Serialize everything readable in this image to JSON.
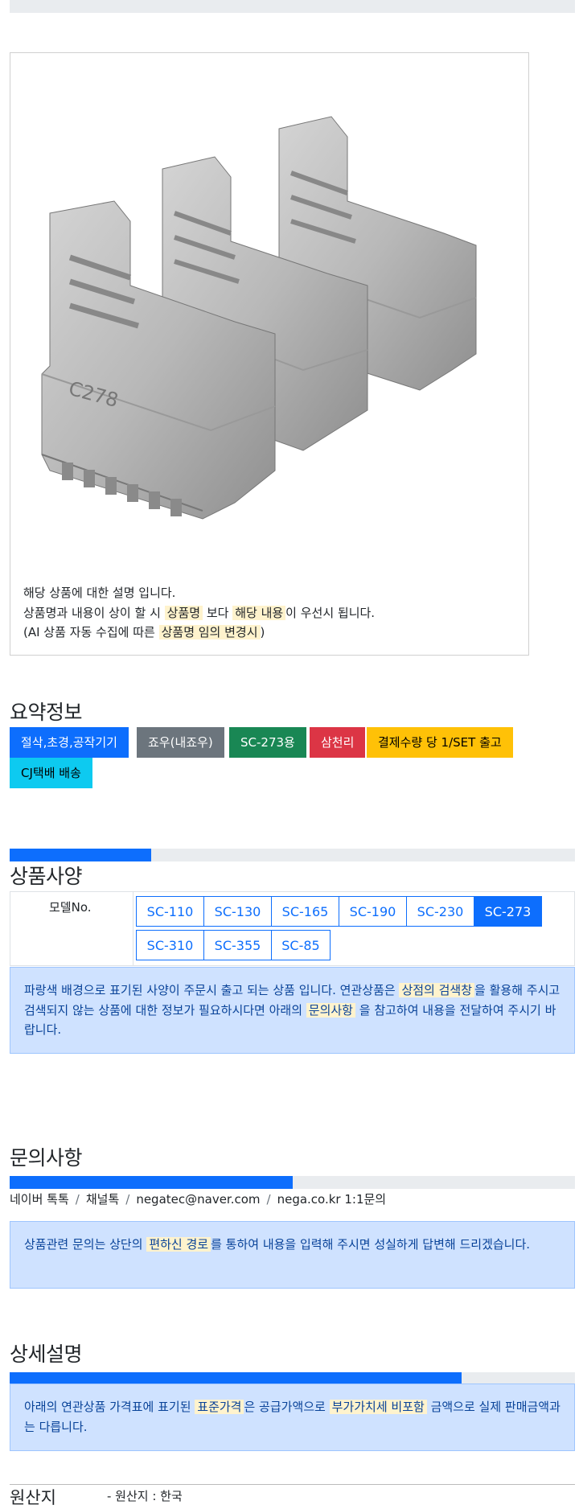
{
  "description": {
    "line1": "해당 상품에 대한 설명 입니다.",
    "line2_a": "상품명과 내용이 상이 할 시 ",
    "line2_h1": "상품명",
    "line2_b": " 보다 ",
    "line2_h2": "해당 내용",
    "line2_c": "이 우선시 됩니다.",
    "line3_a": "(AI 상품 자동 수집에 따른 ",
    "line3_h": "상품명 임의 변경시",
    "line3_b": ")"
  },
  "product_image_alt": "SC-273 soft jaws set",
  "summary": {
    "title": "요약정보",
    "badges": [
      {
        "label": "절삭,초경,공작기기",
        "color": "#0d6efd",
        "text_color": "#ffffff"
      },
      {
        "label": "죠우(내죠우)",
        "color": "#6c757d",
        "text_color": "#ffffff"
      },
      {
        "label": "SC-273용",
        "color": "#198754",
        "text_color": "#ffffff"
      },
      {
        "label": "삼천리",
        "color": "#dc3545",
        "text_color": "#ffffff"
      },
      {
        "label": "결제수량 당 1/SET 출고",
        "color": "#ffc107",
        "text_color": "#000000"
      },
      {
        "label": "CJ택배 배송",
        "color": "#0dcaf0",
        "text_color": "#000000"
      }
    ]
  },
  "specs": {
    "title": "상품사양",
    "progress": 0.25,
    "model_label": "모델No.",
    "models": [
      "SC-110",
      "SC-130",
      "SC-165",
      "SC-190",
      "SC-230",
      "SC-273",
      "SC-310",
      "SC-355",
      "SC-85"
    ],
    "active_model": "SC-273",
    "notice_a": "파랑색 배경으로 표기된 사양이 주문시 출고 되는 상품 입니다. 연관상품은 ",
    "notice_h1": "상점의 검색창",
    "notice_b": "을 활용해 주시고 검색되지 않는 상품에 대한 정보가 필요하시다면 아래의 ",
    "notice_h2": "문의사항",
    "notice_c": " 을 참고하여 내용을 전달하여 주시기 바랍니다."
  },
  "inquiry": {
    "title": "문의사항",
    "progress": 0.5,
    "contacts": [
      "네이버 톡톡",
      "채널톡",
      "negatec@naver.com",
      "nega.co.kr 1:1문의"
    ],
    "notice_a": "상품관련 문의는 상단의 ",
    "notice_h": "편하신 경로",
    "notice_b": "를 통하여 내용을 입력해 주시면 성실하게 답변해 드리겠습니다."
  },
  "detail": {
    "title": "상세설명",
    "progress": 0.8,
    "notice_a": "아래의 연관상품 가격표에 표기된 ",
    "notice_h1": "표준가격",
    "notice_b": "은 공급가액으로 ",
    "notice_h2": "부가가치세 비포함",
    "notice_c": " 금액으로 실제 판매금액과는 다릅니다."
  },
  "origin": {
    "title": "원산지",
    "value": "- 원산지 : 한국"
  }
}
